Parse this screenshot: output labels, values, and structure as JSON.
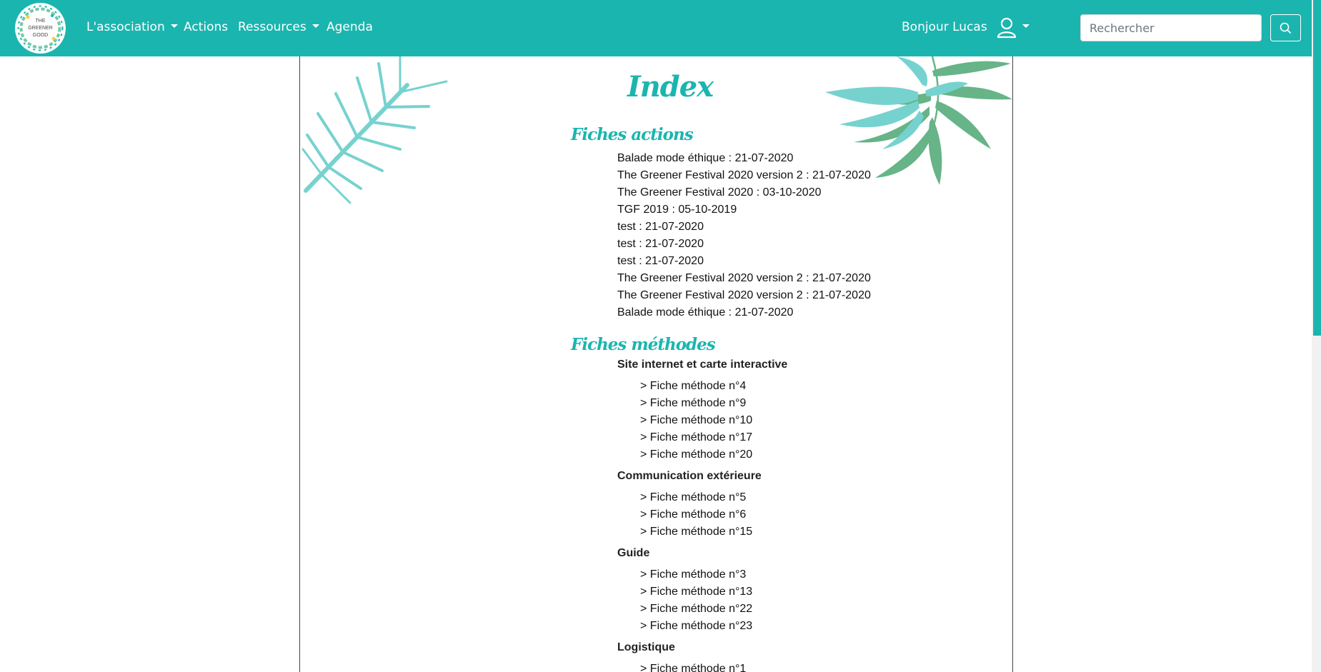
{
  "brand": {
    "logo_lines": [
      "THE",
      "GREENER",
      "GOOD"
    ],
    "logo_icon": "wreath-logo"
  },
  "nav": {
    "items": [
      {
        "label": "L'association",
        "dropdown": true
      },
      {
        "label": "Actions",
        "dropdown": false
      },
      {
        "label": "Ressources",
        "dropdown": true
      },
      {
        "label": "Agenda",
        "dropdown": false
      }
    ],
    "greeting": "Bonjour Lucas",
    "user_icon": "user-icon",
    "search": {
      "placeholder": "Rechercher",
      "value": "",
      "icon": "search-icon"
    }
  },
  "colors": {
    "accent": "#1bb5af",
    "leaf_light": "#76d2cf",
    "leaf_dark": "#66b487"
  },
  "page": {
    "title": "Index",
    "actions_title": "Fiches actions",
    "actions": [
      "Balade mode éthique : 21-07-2020",
      "The Greener Festival 2020 version 2 : 21-07-2020",
      "The Greener Festival 2020 : 03-10-2020",
      "TGF 2019 : 05-10-2019",
      "test : 21-07-2020",
      "test : 21-07-2020",
      "test : 21-07-2020",
      "The Greener Festival 2020 version 2 : 21-07-2020",
      "The Greener Festival 2020 version 2 : 21-07-2020",
      "Balade mode éthique : 21-07-2020"
    ],
    "methodes_title": "Fiches méthodes",
    "methode_groups": [
      {
        "title": "Site internet et carte interactive",
        "items": [
          "> Fiche méthode n°4",
          "> Fiche méthode n°9",
          "> Fiche méthode n°10",
          "> Fiche méthode n°17",
          "> Fiche méthode n°20"
        ]
      },
      {
        "title": "Communication extérieure",
        "items": [
          "> Fiche méthode n°5",
          "> Fiche méthode n°6",
          "> Fiche méthode n°15"
        ]
      },
      {
        "title": "Guide",
        "items": [
          "> Fiche méthode n°3",
          "> Fiche méthode n°13",
          "> Fiche méthode n°22",
          "> Fiche méthode n°23"
        ]
      },
      {
        "title": "Logistique",
        "items": [
          "> Fiche méthode n°1"
        ]
      }
    ]
  }
}
